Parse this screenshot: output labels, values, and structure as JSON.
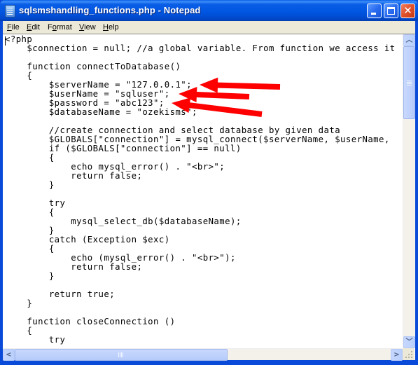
{
  "window": {
    "title": "sqlsmshandling_functions.php - Notepad",
    "app_icon": "notepad-icon",
    "controls": {
      "minimize": "minimize-icon",
      "maximize": "maximize-icon",
      "close": "close-icon"
    }
  },
  "menu": [
    {
      "label": "File",
      "accel": "F",
      "rest": "ile"
    },
    {
      "label": "Edit",
      "accel": "E",
      "rest": "dit"
    },
    {
      "label": "Format",
      "accel": "o",
      "pre": "F",
      "rest": "rmat"
    },
    {
      "label": "View",
      "accel": "V",
      "rest": "iew"
    },
    {
      "label": "Help",
      "accel": "H",
      "rest": "elp"
    }
  ],
  "editor": {
    "lines": [
      "<?php",
      "    $connection = null; //a global variable. From function we access it",
      "",
      "    function connectToDatabase()",
      "    {",
      "        $serverName = \"127.0.0.1\";",
      "        $userName = \"sqluser\";",
      "        $password = \"abc123\";",
      "        $databaseName = \"ozekisms\";",
      "",
      "        //create connection and select database by given data",
      "        $GLOBALS[\"connection\"] = mysql_connect($serverName, $userName,",
      "        if ($GLOBALS[\"connection\"] == null)",
      "        {",
      "            echo mysql_error() . \"<br>\";",
      "            return false;",
      "        }",
      "",
      "        try",
      "        {",
      "            mysql_select_db($databaseName);",
      "        }",
      "        catch (Exception $exc)",
      "        {",
      "            echo (mysql_error() . \"<br>\");",
      "            return false;",
      "        }",
      "",
      "        return true;",
      "    }",
      "",
      "    function closeConnection ()",
      "    {",
      "        try"
    ]
  },
  "annotations": {
    "arrow_color": "#ff0000",
    "arrows_point_to": [
      "serverName-line",
      "userName-line",
      "password-line"
    ]
  },
  "scrollbars": {
    "vertical": {
      "up": "chevron-up-icon",
      "down": "chevron-down-icon"
    },
    "horizontal": {
      "left": "chevron-left-icon",
      "right": "chevron-right-icon"
    }
  }
}
